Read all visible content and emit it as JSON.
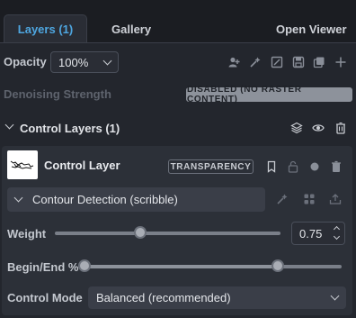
{
  "tabs": {
    "layers": "Layers (1)",
    "gallery": "Gallery",
    "open_viewer": "Open Viewer"
  },
  "opacity": {
    "label": "Opacity",
    "value": "100%"
  },
  "denoise": {
    "label": "Denoising Strength",
    "badge": "DISABLED (NO RASTER CONTENT)"
  },
  "control_layers": {
    "header": "Control Layers (1)",
    "layer": {
      "name": "Control Layer",
      "badge": "TRANSPARENCY",
      "processor": "Contour Detection (scribble)",
      "weight": {
        "label": "Weight",
        "value": "0.75",
        "fraction": 0.38
      },
      "begin_end": {
        "label": "Begin/End %",
        "begin": 0,
        "end": 0.75
      },
      "control_mode": {
        "label": "Control Mode",
        "value": "Balanced (recommended)"
      }
    }
  },
  "colors": {
    "accent": "#4ea6e0",
    "background": "#1b1d22",
    "panel": "#23262d",
    "card": "#2c3038"
  },
  "icons": [
    "user-plus-icon",
    "sparkle-icon",
    "crop-icon",
    "save-icon",
    "copy-icon",
    "plus-icon",
    "layers-icon",
    "eye-icon",
    "trash-icon",
    "bookmark-icon",
    "lock-icon",
    "circle-icon",
    "wand-icon",
    "grid-icon",
    "upload-icon",
    "chevron-down-icon",
    "chevron-up-icon"
  ]
}
